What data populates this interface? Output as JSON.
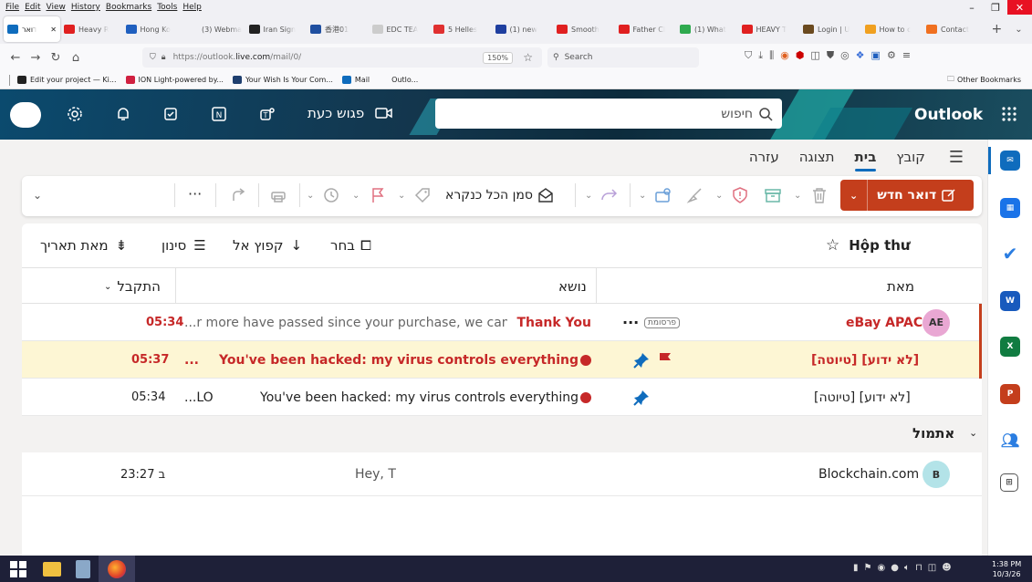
{
  "browser": {
    "menu": [
      "File",
      "Edit",
      "View",
      "History",
      "Bookmarks",
      "Tools",
      "Help"
    ],
    "tabs": [
      {
        "label": "דואר",
        "active": true,
        "color": "#0f6cbd"
      },
      {
        "label": "Heavy R",
        "color": "#e02020"
      },
      {
        "label": "Hong Ko",
        "color": "#1f5fbf"
      },
      {
        "label": "(3) Webmail",
        "color": "#f0f0f4"
      },
      {
        "label": "Iran Sign",
        "color": "#222222"
      },
      {
        "label": "香港01",
        "color": "#1f4fa0"
      },
      {
        "label": "EDC TEA",
        "color": "#cccccc"
      },
      {
        "label": "5 Helles",
        "color": "#e03030"
      },
      {
        "label": "(1) new",
        "color": "#1f3f9f"
      },
      {
        "label": "Smooth",
        "color": "#e02020"
      },
      {
        "label": "Father Cl",
        "color": "#e02020"
      },
      {
        "label": "(1) What",
        "color": "#2faa4f"
      },
      {
        "label": "HEAVY T",
        "color": "#e02020"
      },
      {
        "label": "Login | U",
        "color": "#6b4a1f"
      },
      {
        "label": "How to c",
        "color": "#f0a020"
      },
      {
        "label": "Contact",
        "color": "#f07020"
      }
    ],
    "url_prefix": "https://outlook.",
    "url_domain": "live.com",
    "url_suffix": "/mail/0/",
    "zoom": "150%",
    "search_placeholder": "Search",
    "bookmarks": [
      {
        "label": "Edit your project — Ki...",
        "color": "#222222"
      },
      {
        "label": "ION Light-powered by...",
        "color": "#d02040"
      },
      {
        "label": "Your Wish Is Your Com...",
        "color": "#1f3f6f"
      },
      {
        "label": "Mail",
        "color": "#0f6cbd"
      },
      {
        "label": "Outlo...",
        "color": "#f9f9fb"
      }
    ],
    "other_bookmarks": "Other Bookmarks"
  },
  "outlook": {
    "brand": "Outlook",
    "search_placeholder": "חיפוש",
    "meet_now": "פגוש כעת",
    "ribbon_tabs": [
      {
        "label": "עזרה",
        "selected": false
      },
      {
        "label": "תצוגה",
        "selected": false
      },
      {
        "label": "בית",
        "selected": true
      },
      {
        "label": "קובץ",
        "selected": false
      }
    ],
    "new_mail": "דואר חדש",
    "mark_all_read": "סמן הכל כנקרא",
    "folder_title": "Hộp thư",
    "select_label": "בחר",
    "jump_to_label": "קפוץ אל",
    "filter_label": "סינון",
    "sort_label": "מאת תאריך",
    "col_from": "מאת",
    "col_subject": "נושא",
    "col_received": "התקבל",
    "ad_badge": "פרסומת",
    "yesterday_label": "אתמול",
    "emails": [
      {
        "from": "eBay APAC",
        "avatar": "AE",
        "avatar_color": "#e9a7d3",
        "subject": "Thank You",
        "preview": "...r more have passed since your purchase, we canno",
        "time": "05:34",
        "highlight": false,
        "from_red": true,
        "pinned": false,
        "flag": false,
        "ad": true,
        "unread_dot": false
      },
      {
        "from": "[טיוטה] [לא ידוע]",
        "avatar": "",
        "subject": "You've been hacked: my virus controls everything",
        "preview": "...",
        "time": "05:37",
        "highlight": true,
        "from_red": true,
        "pinned": true,
        "flag": true,
        "ad": false,
        "unread_dot": true
      },
      {
        "from": "[טיוטה] [לא ידוע]",
        "avatar": "",
        "subject": "You've been hacked: my virus controls everything",
        "preview": "...LO",
        "time": "05:34",
        "highlight": false,
        "from_red": false,
        "pinned": true,
        "flag": false,
        "ad": false,
        "unread_dot": true
      },
      {
        "from": "Blockchain.com",
        "avatar": "B",
        "avatar_color": "#b3e3e8",
        "subject": "",
        "preview": "Hey, T",
        "time": "ב 23:27",
        "highlight": false,
        "from_red": false,
        "pinned": false,
        "flag": false,
        "ad": false,
        "unread_dot": false
      }
    ]
  },
  "taskbar": {
    "time": "1:38 PM",
    "date": "10/3/26"
  }
}
